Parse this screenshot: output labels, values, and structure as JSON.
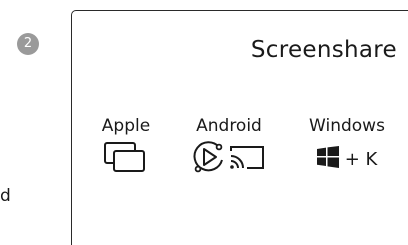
{
  "step": {
    "number": "2"
  },
  "side": {
    "text": "d"
  },
  "panel": {
    "title": "Screenshare",
    "platforms": [
      {
        "label": "Apple",
        "icon": "screen-mirroring-icon"
      },
      {
        "label": "Android",
        "icon": "play-cast-icon"
      },
      {
        "label": "Windows",
        "icon": "windows-logo-icon",
        "shortcut": "+ K"
      }
    ]
  },
  "colors": {
    "badge": "#9a9a9a",
    "text": "#1a1a1a",
    "border": "#2a2a2a"
  }
}
